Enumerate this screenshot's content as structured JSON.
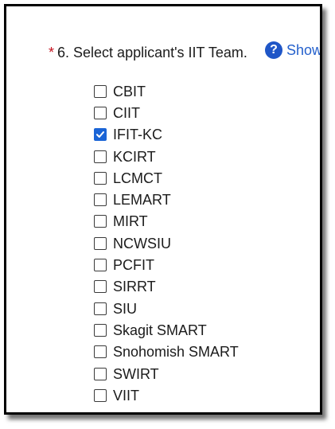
{
  "question": {
    "required_marker": "*",
    "text": "6. Select applicant's IIT Team.",
    "help_icon_glyph": "?",
    "help_link": "Show"
  },
  "options": [
    {
      "label": "CBIT",
      "checked": false
    },
    {
      "label": "CIIT",
      "checked": false
    },
    {
      "label": "IFIT-KC",
      "checked": true
    },
    {
      "label": "KCIRT",
      "checked": false
    },
    {
      "label": "LCMCT",
      "checked": false
    },
    {
      "label": "LEMART",
      "checked": false
    },
    {
      "label": "MIRT",
      "checked": false
    },
    {
      "label": "NCWSIU",
      "checked": false
    },
    {
      "label": "PCFIT",
      "checked": false
    },
    {
      "label": "SIRRT",
      "checked": false
    },
    {
      "label": "SIU",
      "checked": false
    },
    {
      "label": "Skagit SMART",
      "checked": false
    },
    {
      "label": "Snohomish SMART",
      "checked": false
    },
    {
      "label": "SWIRT",
      "checked": false
    },
    {
      "label": "VIIT",
      "checked": false
    }
  ],
  "colors": {
    "accent": "#1a64d6",
    "required": "#c4121e",
    "link": "#2460cc"
  }
}
